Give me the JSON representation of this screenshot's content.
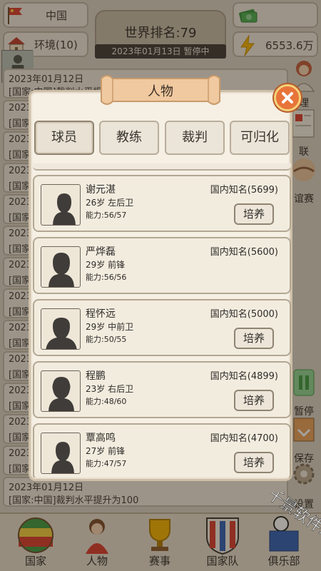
{
  "header": {
    "country": "中国",
    "environment": "环境(10)",
    "money": "6553.6万",
    "world_rank": "世界排名:79",
    "status": "2023年01月13日 暂停中"
  },
  "news_feed": [
    {
      "line1": "2023年01月12日",
      "line2": "[国家:中国]裁判水平提升为100"
    },
    {
      "line1": "2023",
      "line2": "[国家"
    },
    {
      "line1": "2023",
      "line2": "[国家"
    },
    {
      "line1": "2023",
      "line2": "[国家"
    },
    {
      "line1": "2023",
      "line2": "[国家"
    },
    {
      "line1": "2023",
      "line2": "[国家"
    },
    {
      "line1": "2023",
      "line2": "[国家"
    },
    {
      "line1": "2023",
      "line2": "[国家"
    },
    {
      "line1": "2023",
      "line2": "[国家"
    },
    {
      "line1": "2023",
      "line2": "[国家"
    },
    {
      "line1": "2023",
      "line2": "[国家"
    },
    {
      "line1": "2023",
      "line2": "[国家"
    },
    {
      "line1": "2023",
      "line2": "[国家"
    },
    {
      "line1": "2023年01月12日",
      "line2": "[国家:中国]裁判水平提升为100"
    }
  ],
  "side_menu": [
    "理",
    "联",
    "谊赛",
    "暂停",
    "保存",
    "设置"
  ],
  "modal": {
    "title": "人物",
    "tabs": [
      "球员",
      "教练",
      "裁判",
      "可归化"
    ],
    "train_label": "培养",
    "players": [
      {
        "name": "谢元湛",
        "info": "26岁 左后卫",
        "ability": "能力:56/57",
        "fame": "国内知名(5699)",
        "trainable": true
      },
      {
        "name": "严烨磊",
        "info": "29岁 前锋",
        "ability": "能力:56/56",
        "fame": "国内知名(5600)",
        "trainable": false
      },
      {
        "name": "程怀远",
        "info": "29岁 中前卫",
        "ability": "能力:50/55",
        "fame": "国内知名(5000)",
        "trainable": true
      },
      {
        "name": "程鹏",
        "info": "23岁 右后卫",
        "ability": "能力:48/60",
        "fame": "国内知名(4899)",
        "trainable": true
      },
      {
        "name": "覃高鸣",
        "info": "27岁 前锋",
        "ability": "能力:47/57",
        "fame": "国内知名(4700)",
        "trainable": true
      }
    ]
  },
  "bottom_nav": [
    "国家",
    "人物",
    "赛事",
    "国家队",
    "俱乐部"
  ],
  "watermark": "千景软件站",
  "colors": {
    "close_button": "#e8743a",
    "ribbon": "#f0c9a0",
    "accent_green": "#4caf50"
  }
}
